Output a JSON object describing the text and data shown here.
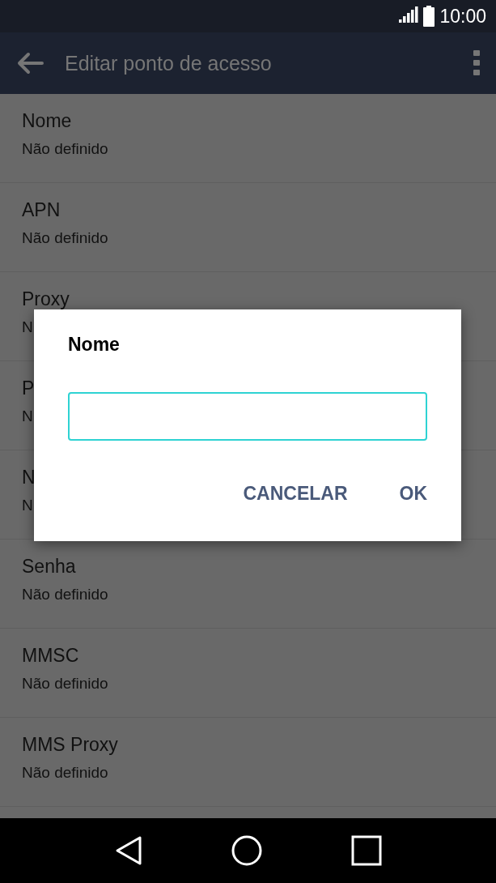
{
  "status_bar": {
    "time": "10:00"
  },
  "app_bar": {
    "title": "Editar ponto de acesso"
  },
  "settings": [
    {
      "title": "Nome",
      "value": "Não definido"
    },
    {
      "title": "APN",
      "value": "Não definido"
    },
    {
      "title": "Proxy",
      "value": "N"
    },
    {
      "title": "P",
      "value": "N"
    },
    {
      "title": "N",
      "value": "N"
    },
    {
      "title": "Senha",
      "value": "Não definido"
    },
    {
      "title": "MMSC",
      "value": "Não definido"
    },
    {
      "title": "MMS Proxy",
      "value": "Não definido"
    }
  ],
  "dialog": {
    "title": "Nome",
    "buttons": [
      "CANCELAR",
      "OK"
    ]
  }
}
